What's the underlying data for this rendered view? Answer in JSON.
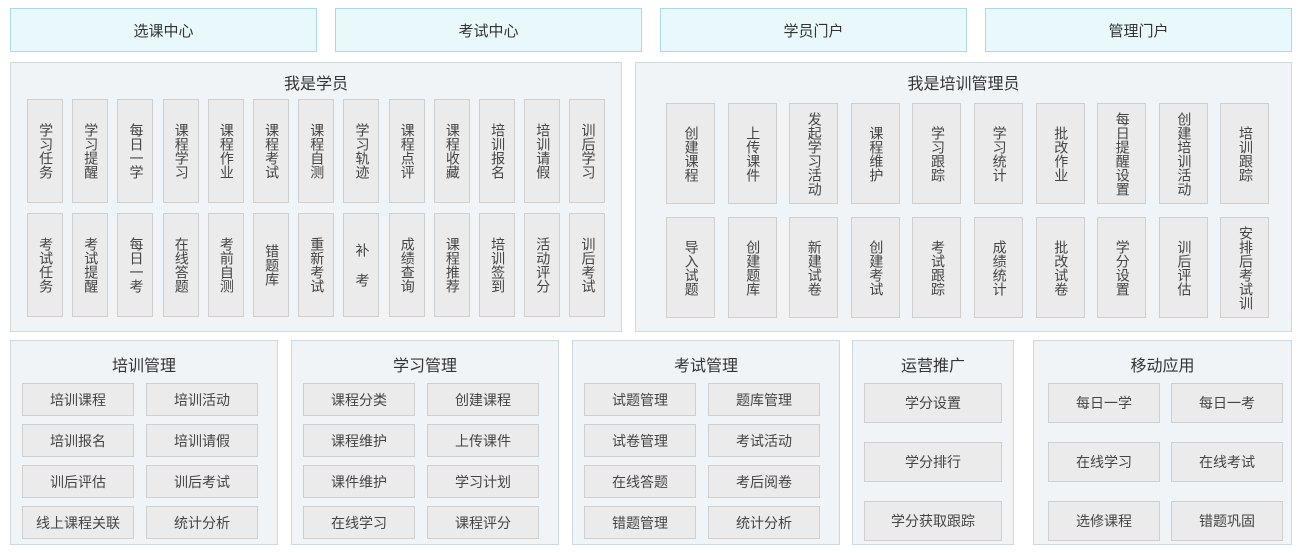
{
  "tabs": [
    "选课中心",
    "考试中心",
    "学员门户",
    "管理门户"
  ],
  "student": {
    "title": "我是学员",
    "row1": [
      "学习任务",
      "学习提醒",
      "每日一学",
      "课程学习",
      "课程作业",
      "课程考试",
      "课程自测",
      "学习轨迹",
      "课程点评",
      "课程收藏",
      "培训报名",
      "培训请假",
      "训后学习"
    ],
    "row2": [
      "考试任务",
      "考试提醒",
      "每日一考",
      "在线答题",
      "考前自测",
      "错题库",
      "重新考试",
      "补 考",
      "成绩查询",
      "课程推荐",
      "培训签到",
      "活动评分",
      "训后考试"
    ]
  },
  "manager": {
    "title": "我是培训管理员",
    "row1": [
      "创建课程",
      "上传课件",
      "发起学习活动",
      "课程维护",
      "学习跟踪",
      "学习统计",
      "批改作业",
      "每日提醒设置",
      "创建培训活动",
      "培训跟踪"
    ],
    "row2": [
      "导入试题",
      "创建题库",
      "新建试卷",
      "创建考试",
      "考试跟踪",
      "成绩统计",
      "批改试卷",
      "学分设置",
      "训后评估",
      "安排后考试训"
    ]
  },
  "training": {
    "title": "培训管理",
    "items": [
      "培训课程",
      "培训活动",
      "培训报名",
      "培训请假",
      "训后评估",
      "训后考试",
      "线上课程关联",
      "统计分析"
    ]
  },
  "learning": {
    "title": "学习管理",
    "items": [
      "课程分类",
      "创建课程",
      "课程维护",
      "上传课件",
      "课件维护",
      "学习计划",
      "在线学习",
      "课程评分"
    ]
  },
  "exam": {
    "title": "考试管理",
    "items": [
      "试题管理",
      "题库管理",
      "试卷管理",
      "考试活动",
      "在线答题",
      "考后阅卷",
      "错题管理",
      "统计分析"
    ]
  },
  "ops": {
    "title": "运营推广",
    "items": [
      "学分设置",
      "学分排行",
      "学分获取跟踪"
    ]
  },
  "mobile": {
    "title": "移动应用",
    "items": [
      "每日一学",
      "每日一考",
      "在线学习",
      "在线考试",
      "选修课程",
      "错题巩固"
    ]
  }
}
